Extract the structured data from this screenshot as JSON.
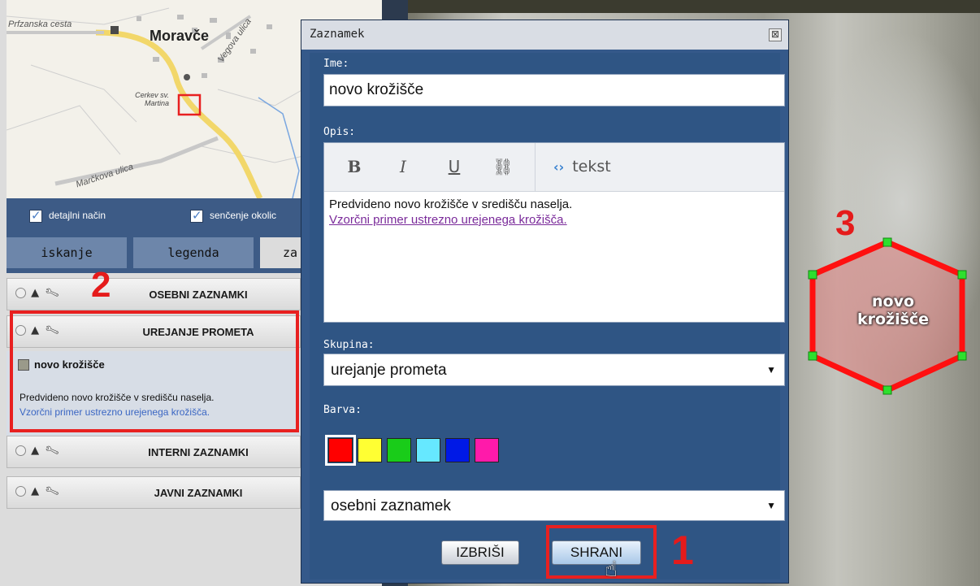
{
  "minimap": {
    "title": "Moravče",
    "road_left": "Prfzanska cesta",
    "road_vegova": "Vegova ulica",
    "church": "Cerkev sv. Martina",
    "road_marcek": "Marčkova ulica"
  },
  "options": {
    "detail_label": "detajlni način",
    "shade_label": "senčenje okolic"
  },
  "tabs": [
    {
      "label": "iskanje"
    },
    {
      "label": "legenda"
    },
    {
      "label": "za"
    }
  ],
  "groups": [
    {
      "label": "OSEBNI ZAZNAMKI"
    },
    {
      "label": "UREJANJE PROMETA"
    },
    {
      "label": "INTERNI ZAZNAMKI"
    },
    {
      "label": "JAVNI ZAZNAMKI"
    }
  ],
  "item": {
    "title": "novo krožišče",
    "desc": "Predvideno novo krožišče v središču naselja.",
    "link": "Vzorčni primer ustrezno urejenega krožišča."
  },
  "dialog": {
    "title": "Zaznamek",
    "close_glyph": "⊠",
    "name_label": "Ime:",
    "name_value": "novo krožišče",
    "desc_label": "Opis:",
    "toolbar": {
      "bold": "B",
      "italic": "I",
      "underline": "U",
      "link": "⛓",
      "source": "tekst"
    },
    "desc_text": "Predvideno novo krožišče v središču naselja.",
    "desc_link": "Vzorčni primer ustrezno urejenega krožišča.",
    "group_label": "Skupina:",
    "group_value": "urejanje prometa",
    "color_label": "Barva:",
    "colors": [
      "#ff0000",
      "#ffff33",
      "#19cc19",
      "#66e8ff",
      "#0019e6",
      "#ff1aaa"
    ],
    "selected_color": "#ff0000",
    "type_value": "osebni zaznamek",
    "delete_label": "IZBRIŠI",
    "save_label": "SHRANI"
  },
  "annotations": {
    "n1": "1",
    "n2": "2",
    "n3": "3"
  },
  "hex_label": "novo krožišče"
}
